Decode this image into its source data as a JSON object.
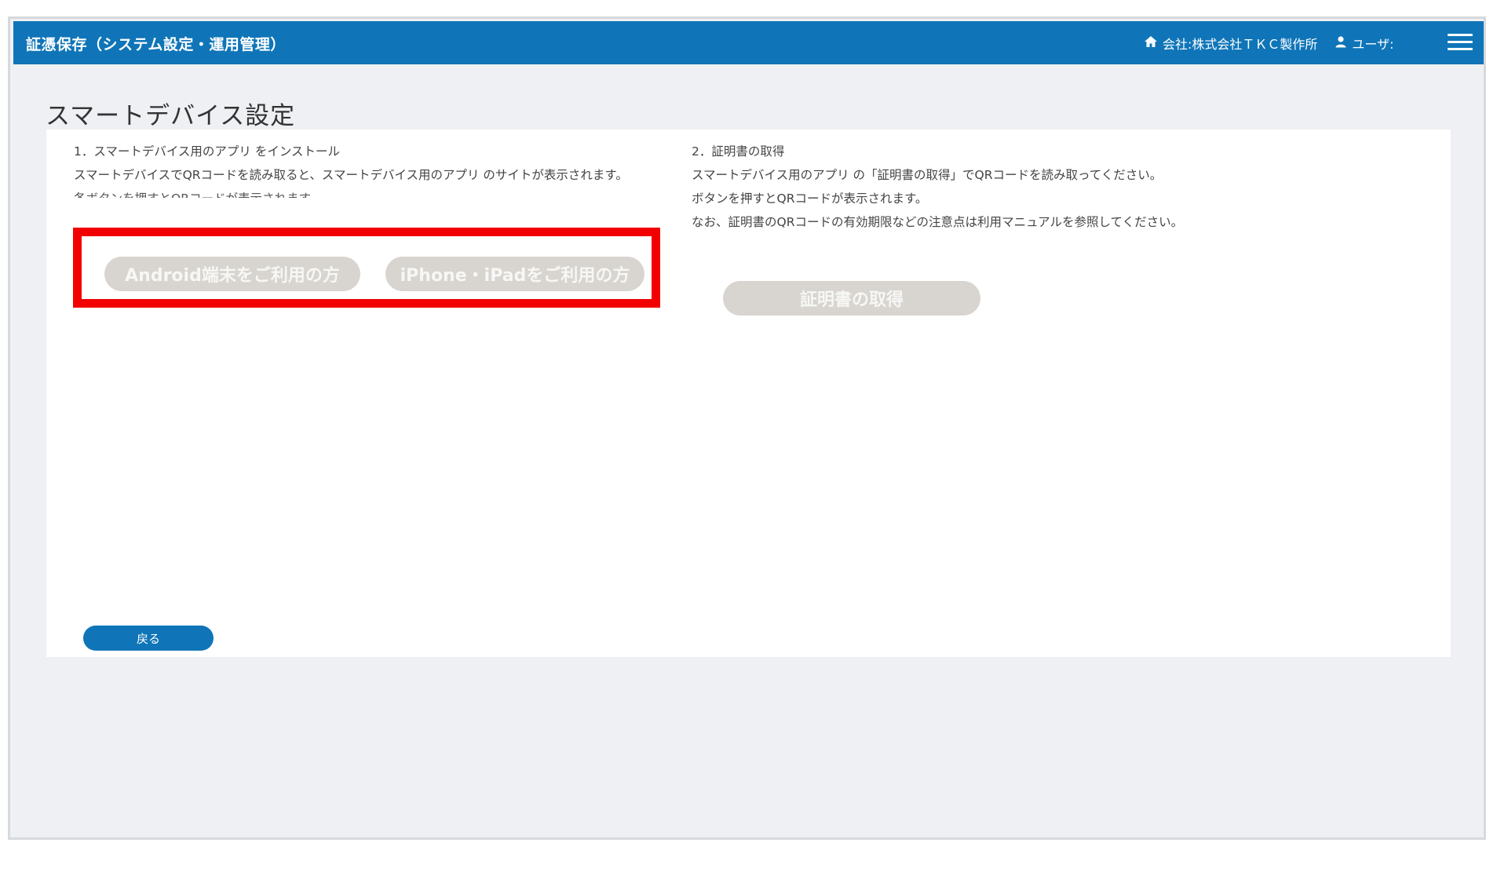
{
  "header": {
    "app_title": "証憑保存（システム設定・運用管理）",
    "company": "会社:株式会社ＴＫＣ製作所",
    "user": "ユーザ:",
    "home_icon": "home-icon",
    "user_icon": "user-icon",
    "menu_icon": "hamburger-menu-icon"
  },
  "page": {
    "title": "スマートデバイス設定"
  },
  "section1": {
    "heading": "1．スマートデバイス用のアプリ をインストール",
    "line1": "スマートデバイスでQRコードを読み取ると、スマートデバイス用のアプリ のサイトが表示されます。",
    "line2": "各ボタンを押すとQRコードが表示されます。",
    "android_button": "Android端末をご利用の方",
    "iphone_button": "iPhone・iPadをご利用の方"
  },
  "section2": {
    "heading": "2．証明書の取得",
    "line1": "スマートデバイス用のアプリ の「証明書の取得」でQRコードを読み取ってください。",
    "line2": "ボタンを押すとQRコードが表示されます。",
    "line3": "なお、証明書のQRコードの有効期限などの注意点は利用マニュアルを参照してください。",
    "cert_button": "証明書の取得"
  },
  "footer": {
    "back_button": "戻る"
  },
  "colors": {
    "header_bg": "#0f75b8",
    "highlight": "#f20000",
    "disabled_button": "#d8d5d0"
  }
}
